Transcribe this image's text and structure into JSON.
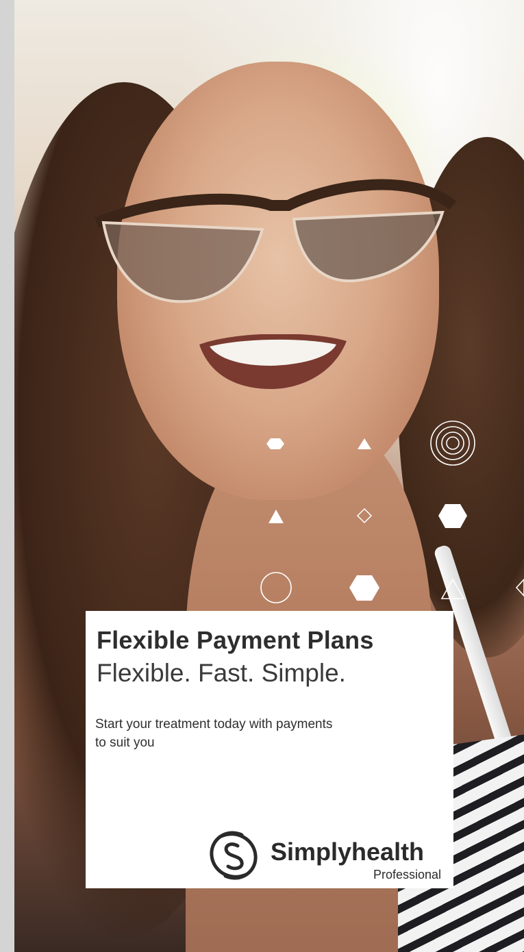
{
  "background": {
    "photo_icon": "woman-smiling-sunglasses-photo",
    "decoration_icons": [
      "hexagon-icon",
      "triangle-icon",
      "concentric-circles-icon",
      "diamond-icon",
      "circle-outline-icon",
      "triangle-outline-icon"
    ]
  },
  "card": {
    "title": "Flexible Payment Plans",
    "subtitle": "Flexible. Fast. Simple.",
    "body": "Start your treatment today with payments to suit you"
  },
  "brand": {
    "name": "Simplyhealth",
    "tagline": "Professional",
    "logo_icon": "simplyhealth-logo-icon"
  },
  "colors": {
    "text_dark": "#2e2e2e",
    "card_bg": "#ffffff",
    "side_strip": "#d4d4d4"
  }
}
